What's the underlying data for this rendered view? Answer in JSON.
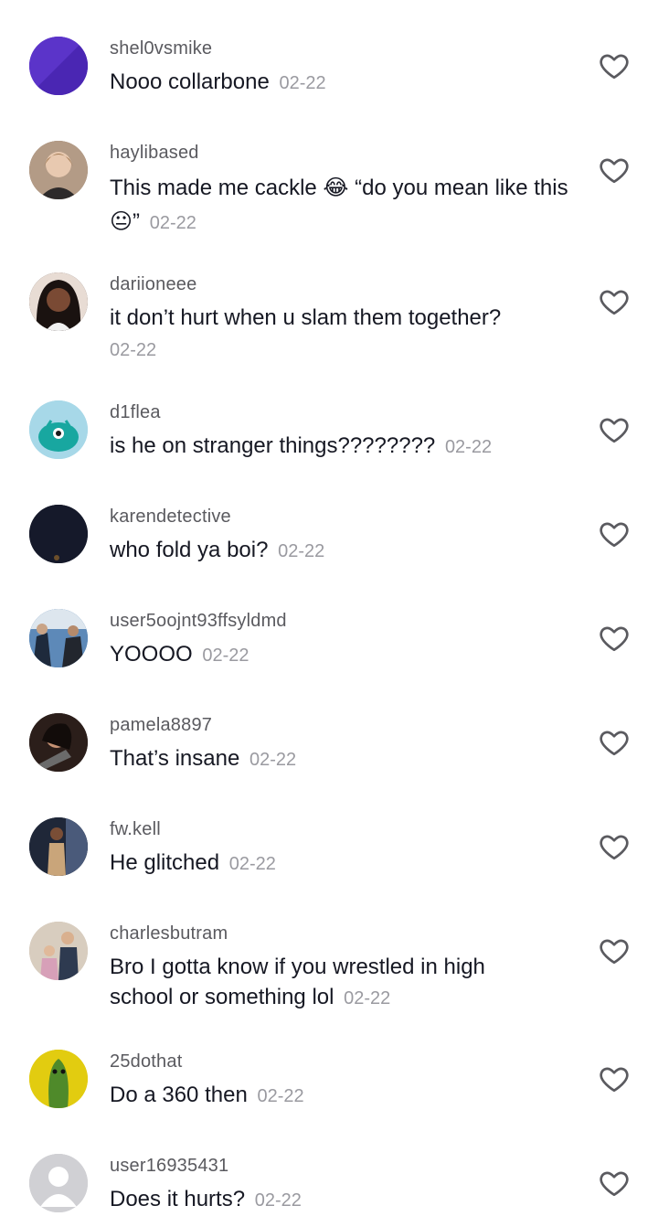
{
  "comments": [
    {
      "username": "shel0vsmike",
      "text": "Nooo collarbone",
      "time": "02-22",
      "avatar_color": "#5b34c9"
    },
    {
      "username": "haylibased",
      "text_a": "This made me cackle",
      "emoji_a": "😂",
      "text_b": "“do you mean like this",
      "emoji_b": "😐",
      "text_c": "”",
      "time": "02-22",
      "avatar_color": "#8a6a55"
    },
    {
      "username": "dariioneee",
      "text": "it don’t hurt when u slam them together?",
      "time": "02-22",
      "avatar_color": "#3b2a24"
    },
    {
      "username": "d1flea",
      "text": "is he on stranger things????????",
      "time": "02-22",
      "avatar_color": "#a7d8e8"
    },
    {
      "username": "karendetective",
      "text": "who fold ya boi?",
      "time": "02-22",
      "avatar_color": "#15192a"
    },
    {
      "username": "user5oojnt93ffsyldmd",
      "text": "YOOOO",
      "time": "02-22",
      "avatar_color": "#3d6ea6"
    },
    {
      "username": "pamela8897",
      "text": "That’s insane",
      "time": "02-22",
      "avatar_color": "#2b1e1a"
    },
    {
      "username": "fw.kell",
      "text": "He glitched",
      "time": "02-22",
      "avatar_color": "#2a3144"
    },
    {
      "username": "charlesbutram",
      "text": "Bro I gotta know if you wrestled in high school or something lol",
      "time": "02-22",
      "avatar_color": "#c9b9a6"
    },
    {
      "username": "25dothat",
      "text": "Do a 360 then",
      "time": "02-22",
      "avatar_color": "#d9c21a"
    },
    {
      "username": "user16935431",
      "text": "Does it hurts?",
      "time": "02-22",
      "avatar_color": "#c8c8cc"
    }
  ],
  "icons": {
    "like": "heart-outline-icon"
  }
}
